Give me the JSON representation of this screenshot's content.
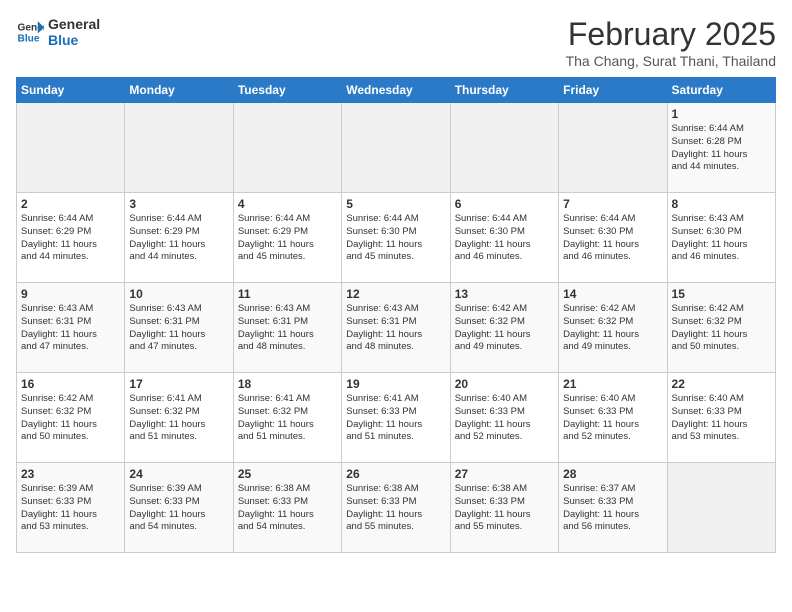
{
  "header": {
    "logo_line1": "General",
    "logo_line2": "Blue",
    "month": "February 2025",
    "location": "Tha Chang, Surat Thani, Thailand"
  },
  "weekdays": [
    "Sunday",
    "Monday",
    "Tuesday",
    "Wednesday",
    "Thursday",
    "Friday",
    "Saturday"
  ],
  "weeks": [
    [
      {
        "day": "",
        "info": ""
      },
      {
        "day": "",
        "info": ""
      },
      {
        "day": "",
        "info": ""
      },
      {
        "day": "",
        "info": ""
      },
      {
        "day": "",
        "info": ""
      },
      {
        "day": "",
        "info": ""
      },
      {
        "day": "1",
        "info": "Sunrise: 6:44 AM\nSunset: 6:28 PM\nDaylight: 11 hours\nand 44 minutes."
      }
    ],
    [
      {
        "day": "2",
        "info": "Sunrise: 6:44 AM\nSunset: 6:29 PM\nDaylight: 11 hours\nand 44 minutes."
      },
      {
        "day": "3",
        "info": "Sunrise: 6:44 AM\nSunset: 6:29 PM\nDaylight: 11 hours\nand 44 minutes."
      },
      {
        "day": "4",
        "info": "Sunrise: 6:44 AM\nSunset: 6:29 PM\nDaylight: 11 hours\nand 45 minutes."
      },
      {
        "day": "5",
        "info": "Sunrise: 6:44 AM\nSunset: 6:30 PM\nDaylight: 11 hours\nand 45 minutes."
      },
      {
        "day": "6",
        "info": "Sunrise: 6:44 AM\nSunset: 6:30 PM\nDaylight: 11 hours\nand 46 minutes."
      },
      {
        "day": "7",
        "info": "Sunrise: 6:44 AM\nSunset: 6:30 PM\nDaylight: 11 hours\nand 46 minutes."
      },
      {
        "day": "8",
        "info": "Sunrise: 6:43 AM\nSunset: 6:30 PM\nDaylight: 11 hours\nand 46 minutes."
      }
    ],
    [
      {
        "day": "9",
        "info": "Sunrise: 6:43 AM\nSunset: 6:31 PM\nDaylight: 11 hours\nand 47 minutes."
      },
      {
        "day": "10",
        "info": "Sunrise: 6:43 AM\nSunset: 6:31 PM\nDaylight: 11 hours\nand 47 minutes."
      },
      {
        "day": "11",
        "info": "Sunrise: 6:43 AM\nSunset: 6:31 PM\nDaylight: 11 hours\nand 48 minutes."
      },
      {
        "day": "12",
        "info": "Sunrise: 6:43 AM\nSunset: 6:31 PM\nDaylight: 11 hours\nand 48 minutes."
      },
      {
        "day": "13",
        "info": "Sunrise: 6:42 AM\nSunset: 6:32 PM\nDaylight: 11 hours\nand 49 minutes."
      },
      {
        "day": "14",
        "info": "Sunrise: 6:42 AM\nSunset: 6:32 PM\nDaylight: 11 hours\nand 49 minutes."
      },
      {
        "day": "15",
        "info": "Sunrise: 6:42 AM\nSunset: 6:32 PM\nDaylight: 11 hours\nand 50 minutes."
      }
    ],
    [
      {
        "day": "16",
        "info": "Sunrise: 6:42 AM\nSunset: 6:32 PM\nDaylight: 11 hours\nand 50 minutes."
      },
      {
        "day": "17",
        "info": "Sunrise: 6:41 AM\nSunset: 6:32 PM\nDaylight: 11 hours\nand 51 minutes."
      },
      {
        "day": "18",
        "info": "Sunrise: 6:41 AM\nSunset: 6:32 PM\nDaylight: 11 hours\nand 51 minutes."
      },
      {
        "day": "19",
        "info": "Sunrise: 6:41 AM\nSunset: 6:33 PM\nDaylight: 11 hours\nand 51 minutes."
      },
      {
        "day": "20",
        "info": "Sunrise: 6:40 AM\nSunset: 6:33 PM\nDaylight: 11 hours\nand 52 minutes."
      },
      {
        "day": "21",
        "info": "Sunrise: 6:40 AM\nSunset: 6:33 PM\nDaylight: 11 hours\nand 52 minutes."
      },
      {
        "day": "22",
        "info": "Sunrise: 6:40 AM\nSunset: 6:33 PM\nDaylight: 11 hours\nand 53 minutes."
      }
    ],
    [
      {
        "day": "23",
        "info": "Sunrise: 6:39 AM\nSunset: 6:33 PM\nDaylight: 11 hours\nand 53 minutes."
      },
      {
        "day": "24",
        "info": "Sunrise: 6:39 AM\nSunset: 6:33 PM\nDaylight: 11 hours\nand 54 minutes."
      },
      {
        "day": "25",
        "info": "Sunrise: 6:38 AM\nSunset: 6:33 PM\nDaylight: 11 hours\nand 54 minutes."
      },
      {
        "day": "26",
        "info": "Sunrise: 6:38 AM\nSunset: 6:33 PM\nDaylight: 11 hours\nand 55 minutes."
      },
      {
        "day": "27",
        "info": "Sunrise: 6:38 AM\nSunset: 6:33 PM\nDaylight: 11 hours\nand 55 minutes."
      },
      {
        "day": "28",
        "info": "Sunrise: 6:37 AM\nSunset: 6:33 PM\nDaylight: 11 hours\nand 56 minutes."
      },
      {
        "day": "",
        "info": ""
      }
    ]
  ]
}
